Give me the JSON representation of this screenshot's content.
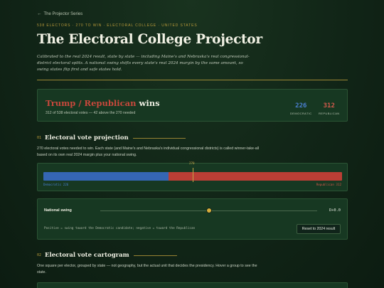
{
  "nav": {
    "back_label": "The Projector Series"
  },
  "header": {
    "kicker": "538 ELECTORS · 270 TO WIN · ELECTORAL COLLEGE · UNITED STATES",
    "title": "The Electoral College Projector",
    "lede": "Calibrated to the real 2024 result, state by state — including Maine's and Nebraska's real congressional-district electoral splits. A national swing shifts every state's real 2024 margin by the same amount, so swing states flip first and safe states hold."
  },
  "result": {
    "winner_party": "Trump / Republican",
    "winner_suffix": "wins",
    "summary": "312 of 538 electoral votes — 42 above the 270 needed",
    "dem_votes": "226",
    "dem_label": "DEMOCRATIC",
    "rep_votes": "312",
    "rep_label": "REPUBLICAN",
    "dem_color": "#4a7fd0",
    "rep_color": "#d25a4c"
  },
  "projection": {
    "number": "01",
    "heading": "Electoral vote projection",
    "description": "270 electoral votes needed to win. Each state (and Maine's and Nebraska's individual congressional districts) is called winner-take-all based on its own real 2024 margin plus your national swing.",
    "threshold_label": "270",
    "dem_bar_label": "Democratic 226",
    "rep_bar_label": "Republican 312",
    "dem_share": 0.42,
    "rep_share": 0.58
  },
  "swing": {
    "label": "National swing",
    "value": "D+0.0",
    "position": 0.5,
    "note": "Positive = swing toward the Democratic candidate; negative = toward the Republican",
    "reset_label": "Reset to 2024 result"
  },
  "cartogram": {
    "number": "02",
    "heading": "Electoral vote cartogram",
    "description": "One square per elector, grouped by state — not geography, but the actual unit that decides the presidency. Hover a group to see the state."
  }
}
